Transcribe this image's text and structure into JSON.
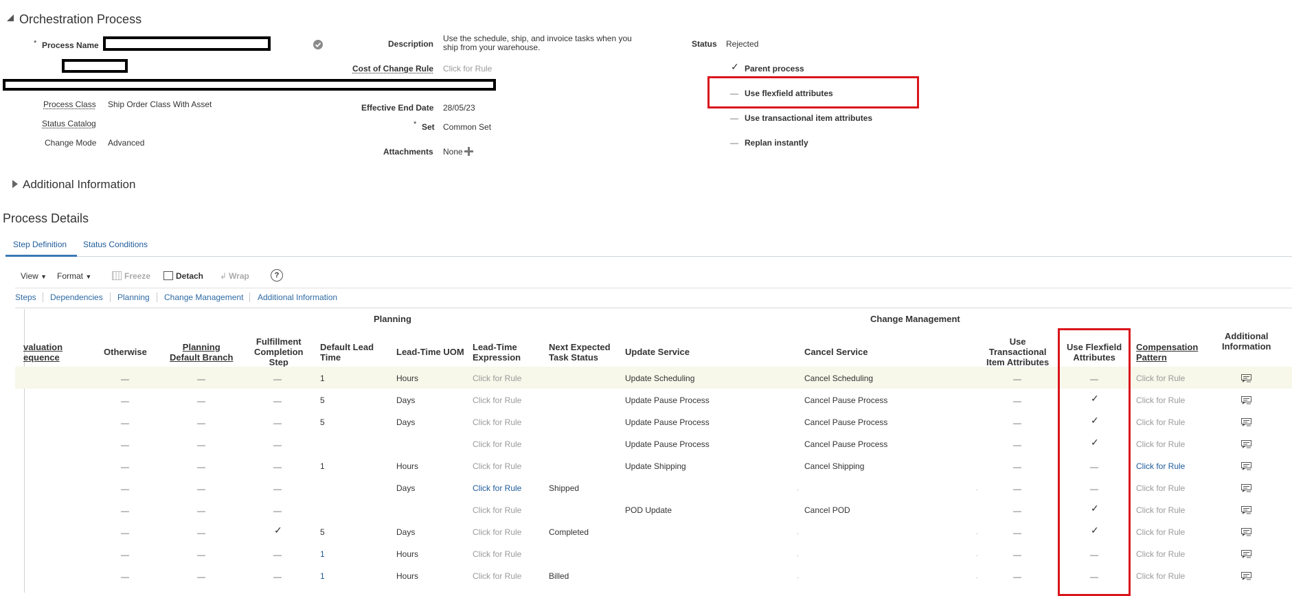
{
  "section": {
    "title": "Orchestration Process"
  },
  "form": {
    "process_name_label": "Process Name",
    "required_mark": "*",
    "description_label": "Description",
    "description_value": "Use the schedule, ship, and invoice tasks when you ship from your warehouse.",
    "cost_rule_label": "Cost of Change Rule",
    "cost_rule_value": "Click for Rule",
    "status_label": "Status",
    "status_value": "Rejected",
    "process_class_label": "Process Class",
    "process_class_value": "Ship Order Class With Asset",
    "status_catalog_label": "Status Catalog",
    "change_mode_label": "Change Mode",
    "change_mode_value": "Advanced",
    "effective_end_label": "Effective End Date",
    "effective_end_value": "28/05/23",
    "set_label": "Set",
    "set_value": "Common Set",
    "attachments_label": "Attachments",
    "attachments_value": "None"
  },
  "flags": [
    {
      "label": "Parent process",
      "checked": true
    },
    {
      "label": "Use flexfield attributes",
      "checked": false
    },
    {
      "label": "Use transactional item attributes",
      "checked": false
    },
    {
      "label": "Replan instantly",
      "checked": false
    }
  ],
  "additional_info": {
    "label": "Additional Information"
  },
  "process_details": {
    "title": "Process Details",
    "tabs": [
      "Step Definition",
      "Status Conditions"
    ]
  },
  "toolbar": {
    "view": "View",
    "format": "Format",
    "freeze": "Freeze",
    "detach": "Detach",
    "wrap": "Wrap",
    "help": "?"
  },
  "categories": [
    "Steps",
    "Dependencies",
    "Planning",
    "Change Management",
    "Additional Information"
  ],
  "group_headers": {
    "planning": "Planning",
    "change_management": "Change Management"
  },
  "columns": {
    "evaluation_sequence_1": "valuation",
    "evaluation_sequence_2": "equence",
    "otherwise": "Otherwise",
    "planning_default_branch_1": "Planning",
    "planning_default_branch_2": "Default Branch",
    "fulfillment_1": "Fulfillment",
    "fulfillment_2": "Completion",
    "fulfillment_3": "Step",
    "default_lead_1": "Default Lead",
    "default_lead_2": "Time",
    "lead_uom": "Lead-Time UOM",
    "lead_expr_1": "Lead-Time",
    "lead_expr_2": "Expression",
    "next_status_1": "Next Expected",
    "next_status_2": "Task Status",
    "update_service": "Update Service",
    "cancel_service": "Cancel Service",
    "use_trans_1": "Use",
    "use_trans_2": "Transactional",
    "use_trans_3": "Item Attributes",
    "use_flex_1": "Use Flexfield",
    "use_flex_2": "Attributes",
    "comp_pattern_1": "Compensation",
    "comp_pattern_2": "Pattern",
    "additional_info_1": "Additional",
    "additional_info_2": "Information"
  },
  "dash_glyph": "—",
  "check_glyph": "✓",
  "rows": [
    {
      "lead": "1",
      "uom": "Hours",
      "expr": "Click for Rule",
      "expr_link": false,
      "next": "",
      "update": "Update Scheduling",
      "cancel": "Cancel Scheduling",
      "fulfill": false,
      "flex": false,
      "comp": "Click for Rule",
      "comp_link": false,
      "dots": false,
      "lead_link": false
    },
    {
      "lead": "5",
      "uom": "Days",
      "expr": "Click for Rule",
      "expr_link": false,
      "next": "",
      "update": "Update Pause Process",
      "cancel": "Cancel Pause Process",
      "fulfill": false,
      "flex": true,
      "comp": "Click for Rule",
      "comp_link": false,
      "dots": false,
      "lead_link": false
    },
    {
      "lead": "5",
      "uom": "Days",
      "expr": "Click for Rule",
      "expr_link": false,
      "next": "",
      "update": "Update Pause Process",
      "cancel": "Cancel Pause Process",
      "fulfill": false,
      "flex": true,
      "comp": "Click for Rule",
      "comp_link": false,
      "dots": false,
      "lead_link": false
    },
    {
      "lead": "",
      "uom": "",
      "expr": "Click for Rule",
      "expr_link": false,
      "next": "",
      "update": "Update Pause Process",
      "cancel": "Cancel Pause Process",
      "fulfill": false,
      "flex": true,
      "comp": "Click for Rule",
      "comp_link": false,
      "dots": false,
      "lead_link": false
    },
    {
      "lead": "1",
      "uom": "Hours",
      "expr": "Click for Rule",
      "expr_link": false,
      "next": "",
      "update": "Update Shipping",
      "cancel": "Cancel Shipping",
      "fulfill": false,
      "flex": false,
      "comp": "Click for Rule",
      "comp_link": true,
      "dots": false,
      "lead_link": false
    },
    {
      "lead": "",
      "uom": "Days",
      "expr": "Click for Rule",
      "expr_link": true,
      "next": "Shipped",
      "update": "",
      "cancel": "",
      "fulfill": false,
      "flex": false,
      "comp": "Click for Rule",
      "comp_link": false,
      "dots": true,
      "lead_link": false
    },
    {
      "lead": "",
      "uom": "",
      "expr": "Click for Rule",
      "expr_link": false,
      "next": "",
      "update": "POD Update",
      "cancel": "Cancel POD",
      "fulfill": false,
      "flex": true,
      "comp": "Click for Rule",
      "comp_link": false,
      "dots": false,
      "lead_link": false
    },
    {
      "lead": "5",
      "uom": "Days",
      "expr": "Click for Rule",
      "expr_link": false,
      "next": "Completed",
      "update": "",
      "cancel": "",
      "fulfill": true,
      "flex": true,
      "comp": "Click for Rule",
      "comp_link": false,
      "dots": true,
      "lead_link": false
    },
    {
      "lead": "1",
      "uom": "Hours",
      "expr": "Click for Rule",
      "expr_link": false,
      "next": "",
      "update": "",
      "cancel": "",
      "fulfill": false,
      "flex": false,
      "comp": "Click for Rule",
      "comp_link": false,
      "dots": true,
      "lead_link": true
    },
    {
      "lead": "1",
      "uom": "Hours",
      "expr": "Click for Rule",
      "expr_link": false,
      "next": "Billed",
      "update": "",
      "cancel": "",
      "fulfill": false,
      "flex": false,
      "comp": "Click for Rule",
      "comp_link": false,
      "dots": true,
      "lead_link": true
    }
  ]
}
